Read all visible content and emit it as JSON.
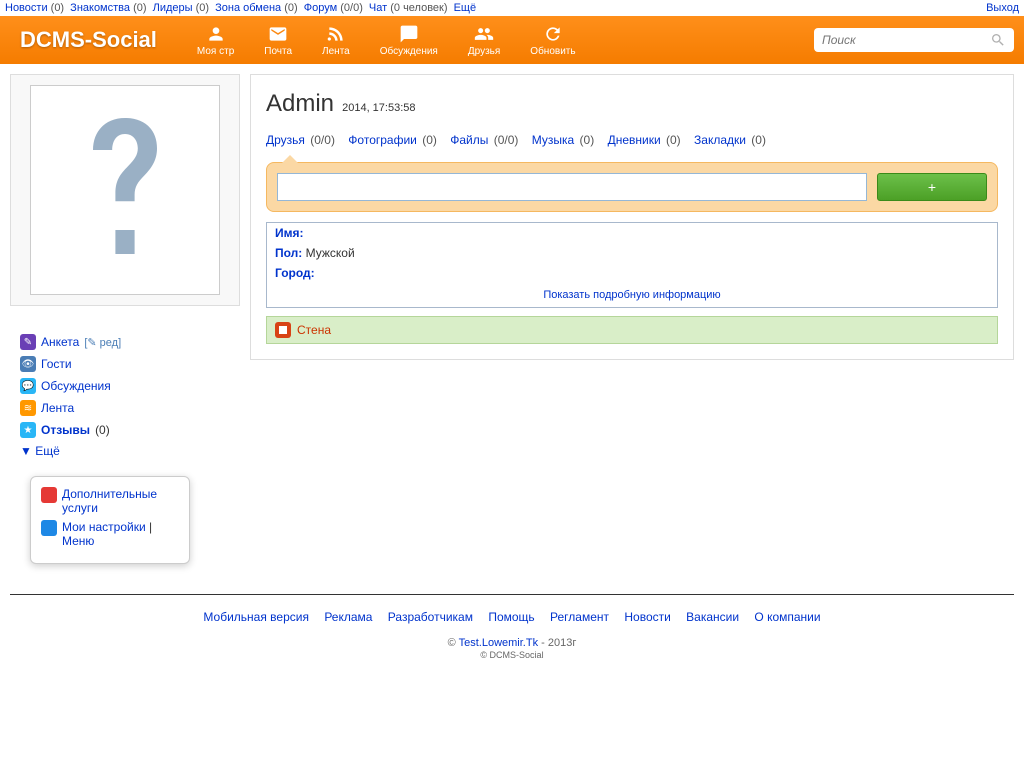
{
  "topbar": {
    "items": [
      {
        "label": "Новости",
        "count": "(0)"
      },
      {
        "label": "Знакомства",
        "count": "(0)"
      },
      {
        "label": "Лидеры",
        "count": "(0)"
      },
      {
        "label": "Зона обмена",
        "count": "(0)"
      },
      {
        "label": "Форум",
        "count": "(0/0)"
      },
      {
        "label": "Чат",
        "count": "(0 человек)"
      }
    ],
    "more": "Ещё",
    "logout": "Выход"
  },
  "logo": "DCMS-Social",
  "nav": [
    {
      "label": "Моя стр"
    },
    {
      "label": "Почта"
    },
    {
      "label": "Лента"
    },
    {
      "label": "Обсуждения"
    },
    {
      "label": "Друзья"
    },
    {
      "label": "Обновить"
    }
  ],
  "search": {
    "placeholder": "Поиск"
  },
  "sideMenu": {
    "items": [
      {
        "label": "Анкета",
        "edit": "[✎ ред]",
        "color": "#6a3fb5"
      },
      {
        "label": "Гости",
        "color": "#4a7db5"
      },
      {
        "label": "Обсуждения",
        "color": "#29b6f6"
      },
      {
        "label": "Лента",
        "color": "#ff9800"
      },
      {
        "label": "Отзывы",
        "count": "(0)",
        "bold": true,
        "color": "#29b6f6"
      }
    ],
    "more": "▼ Ещё"
  },
  "popup": {
    "item1": "Дополнительные услуги",
    "item2": "Мои настройки",
    "sep": " | ",
    "item3": "Меню"
  },
  "profile": {
    "name": "Admin",
    "timestamp": "2014, 17:53:58"
  },
  "profileNav": [
    {
      "label": "Друзья",
      "count": "(0/0)"
    },
    {
      "label": "Фотографии",
      "count": "(0)"
    },
    {
      "label": "Файлы",
      "count": "(0/0)"
    },
    {
      "label": "Музыка",
      "count": "(0)"
    },
    {
      "label": "Дневники",
      "count": "(0)"
    },
    {
      "label": "Закладки",
      "count": "(0)"
    }
  ],
  "statusBtn": "+",
  "info": {
    "name_lbl": "Имя:",
    "gender_lbl": "Пол:",
    "gender_val": "Мужской",
    "city_lbl": "Город:",
    "showMore": "Показать подробную информацию"
  },
  "wall": "Стена",
  "footer": {
    "links": [
      "Мобильная версия",
      "Реклама",
      "Разработчикам",
      "Помощь",
      "Регламент",
      "Новости",
      "Вакансии",
      "О компании"
    ],
    "copy_pre": "©  ",
    "site": "Test.Lowemir.Tk",
    "copy_post": "  - 2013г",
    "sub": "© DCMS-Social"
  }
}
